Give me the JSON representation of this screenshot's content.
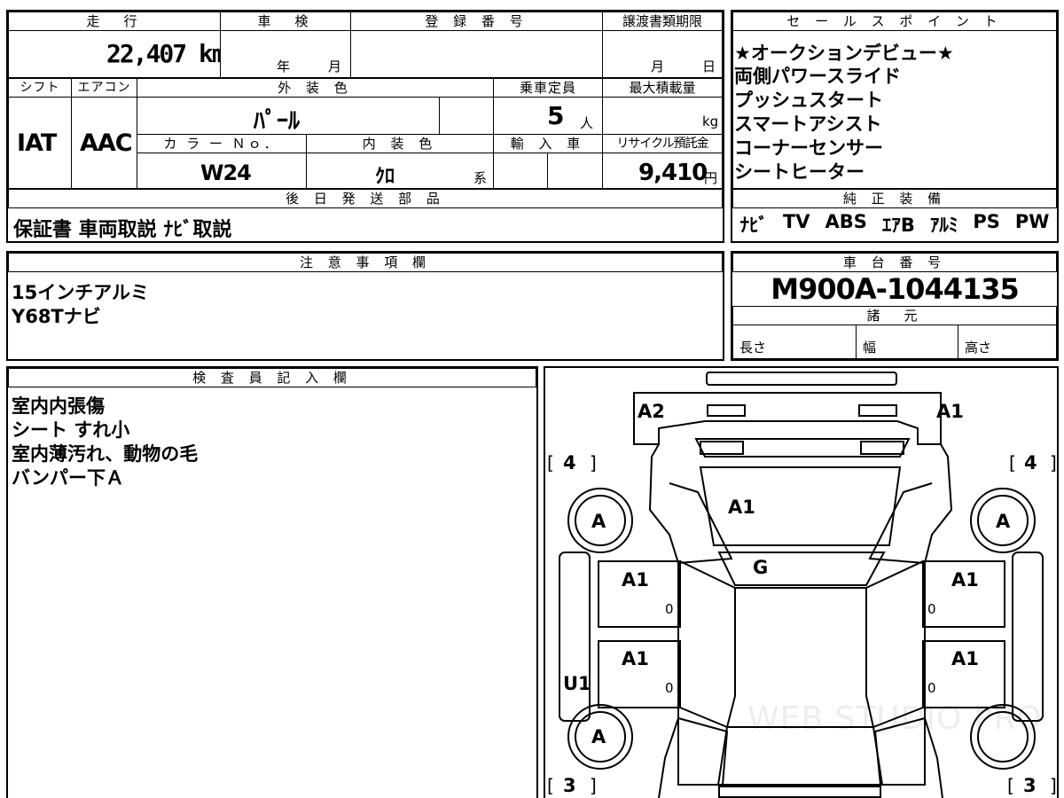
{
  "main_table": {
    "mileage_header": "走　行",
    "mileage_value": "22,407 km",
    "inspection_header": "車　検",
    "inspection_year": "年",
    "inspection_month": "月",
    "registration_header": "登 録 番 号",
    "transfer_header": "譲渡書類期限",
    "transfer_month": "月",
    "transfer_day": "日",
    "shift_header": "シフト",
    "shift_value": "IAT",
    "ac_header": "エアコン",
    "ac_value": "AAC",
    "exterior_color_header": "外 装 色",
    "exterior_color_value": "ﾊﾟｰﾙ",
    "capacity_header": "乗車定員",
    "capacity_value": "5",
    "capacity_unit": "人",
    "max_load_header": "最大積載量",
    "max_load_unit": "kg",
    "color_no_header": "カ ラ ー Ｎｏ．",
    "color_no_value": "W24",
    "interior_color_header": "内 装 色",
    "interior_color_value": "ｸﾛ",
    "interior_color_suffix": "系",
    "import_header": "輸 入 車",
    "recycle_header": "リサイクル預託金",
    "recycle_value": "9,410",
    "recycle_unit": "円",
    "later_parts_header": "後 日 発 送 部 品",
    "later_parts_value": "保証書 車両取説 ﾅﾋﾞ取説"
  },
  "sales_points": {
    "header": "セ ー ル ス ポ イ ン ト",
    "items": [
      "★オークションデビュー★",
      "両側パワースライド",
      "プッシュスタート",
      "スマートアシスト",
      "コーナーセンサー",
      "シートヒーター"
    ]
  },
  "standard_equipment": {
    "header": "純 正 装 備",
    "items": [
      "ﾅﾋﾞ",
      "TV",
      "ABS",
      "ｴｱB",
      "ｱﾙﾐ",
      "PS",
      "PW"
    ]
  },
  "notes": {
    "header": "注 意 事 項 欄",
    "lines": [
      "15インチアルミ",
      "Y68Tナビ"
    ]
  },
  "chassis": {
    "header": "車 台 番 号",
    "value": "M900A-1044135",
    "specs_header": "諸　元",
    "length_label": "長さ",
    "width_label": "幅",
    "height_label": "高さ"
  },
  "inspector": {
    "header": "検 査 員 記 入 欄",
    "lines": [
      "室内内張傷",
      "シート すれ小",
      "室内薄汚れ、動物の毛",
      "バンパー下Ａ"
    ]
  },
  "diagram": {
    "bracket_open": "[",
    "bracket_close": "]",
    "tire_front_left": "4",
    "tire_front_right": "4",
    "tire_rear_left": "3",
    "tire_rear_right": "3",
    "front_left_mark": "A2",
    "front_right_mark": "A1",
    "hood_mark": "A1",
    "windshield_mark": "G",
    "front_left_wheel": "A",
    "front_right_wheel": "A",
    "rear_left_wheel": "A",
    "left_front_door": "A1",
    "left_rear_door": "A1",
    "right_front_door": "A1",
    "right_rear_door": "A1",
    "left_sill": "U1",
    "door_zero": "0",
    "watermark": "WEB STUDIO PRO"
  }
}
